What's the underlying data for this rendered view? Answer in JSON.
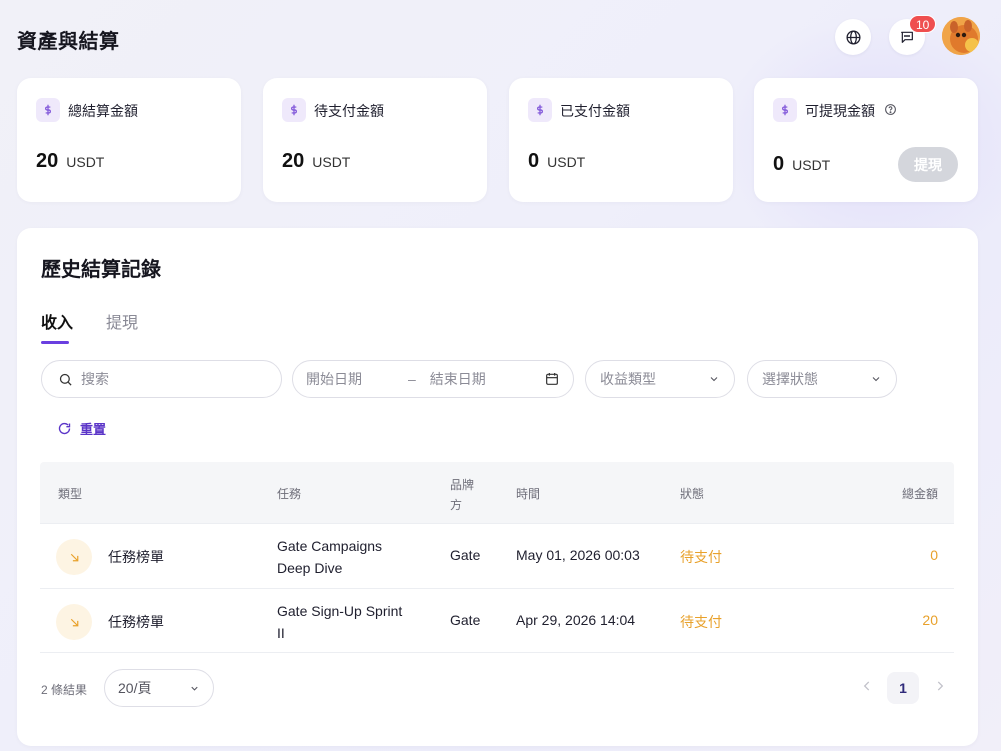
{
  "header": {
    "title": "資產與結算",
    "notification_count": "10",
    "icons": {
      "language": "globe-icon",
      "messages": "chat-icon",
      "avatar": "user-avatar"
    }
  },
  "summary_cards": [
    {
      "label": "總結算金額",
      "value": "20",
      "unit": "USDT"
    },
    {
      "label": "待支付金額",
      "value": "20",
      "unit": "USDT"
    },
    {
      "label": "已支付金額",
      "value": "0",
      "unit": "USDT"
    },
    {
      "label": "可提現金額",
      "value": "0",
      "unit": "USDT",
      "action_label": "提現",
      "action_enabled": false
    }
  ],
  "history": {
    "title": "歷史結算記錄",
    "tabs": [
      {
        "label": "收入",
        "active": true
      },
      {
        "label": "提現",
        "active": false
      }
    ],
    "filters": {
      "search_placeholder": "搜索",
      "start_date_placeholder": "開始日期",
      "end_date_placeholder": "結束日期",
      "date_separator": "–",
      "type_select": "收益類型",
      "status_select": "選擇狀態",
      "reset_label": "重置"
    },
    "columns": {
      "type": "類型",
      "task": "任務",
      "brand": "品牌方",
      "time": "時間",
      "status": "狀態",
      "amount": "總金額"
    },
    "rows": [
      {
        "type": "任務榜單",
        "task_line1": "Gate Campaigns",
        "task_line2": "Deep Dive",
        "brand": "Gate",
        "time": "May 01, 2026 00:03",
        "status": "待支付",
        "amount": "0"
      },
      {
        "type": "任務榜單",
        "task_line1": "Gate Sign-Up Sprint",
        "task_line2": "II",
        "brand": "Gate",
        "time": "Apr 29, 2026 14:04",
        "status": "待支付",
        "amount": "20"
      }
    ],
    "footer": {
      "result_count": "2 條結果",
      "page_size": "20/頁",
      "current_page": "1"
    }
  },
  "colors": {
    "accent": "#6a3fe0",
    "pending": "#e8a12b",
    "badge": "#ef4f4f",
    "disabled_button": "#d4d6dc"
  }
}
